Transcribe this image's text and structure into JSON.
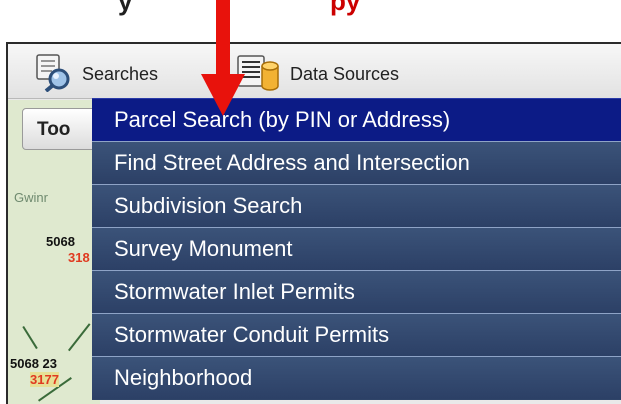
{
  "header": {
    "top_text_dark": "y",
    "top_text_red": "py"
  },
  "toolbar": {
    "searches_label": "Searches",
    "datasources_label": "Data Sources"
  },
  "panel": {
    "tools_tab_label": "Too",
    "map_label": "Gwinr",
    "parcels": [
      {
        "number": "5068",
        "sub": "318"
      },
      {
        "number": "5068 23",
        "sub": "3177"
      }
    ]
  },
  "menu": {
    "items": [
      {
        "label": "Parcel Search (by PIN or Address)",
        "active": true
      },
      {
        "label": "Find Street Address and Intersection",
        "active": false
      },
      {
        "label": "Subdivision Search",
        "active": false
      },
      {
        "label": "Survey Monument",
        "active": false
      },
      {
        "label": "Stormwater Inlet Permits",
        "active": false
      },
      {
        "label": "Stormwater Conduit Permits",
        "active": false
      },
      {
        "label": "Neighborhood",
        "active": false
      }
    ]
  },
  "colors": {
    "menu_bg": "#2f4468",
    "menu_active": "#0c1b86",
    "arrow": "#e8120c"
  },
  "icons": [
    "search-icon",
    "database-icon",
    "red-arrow-icon"
  ]
}
